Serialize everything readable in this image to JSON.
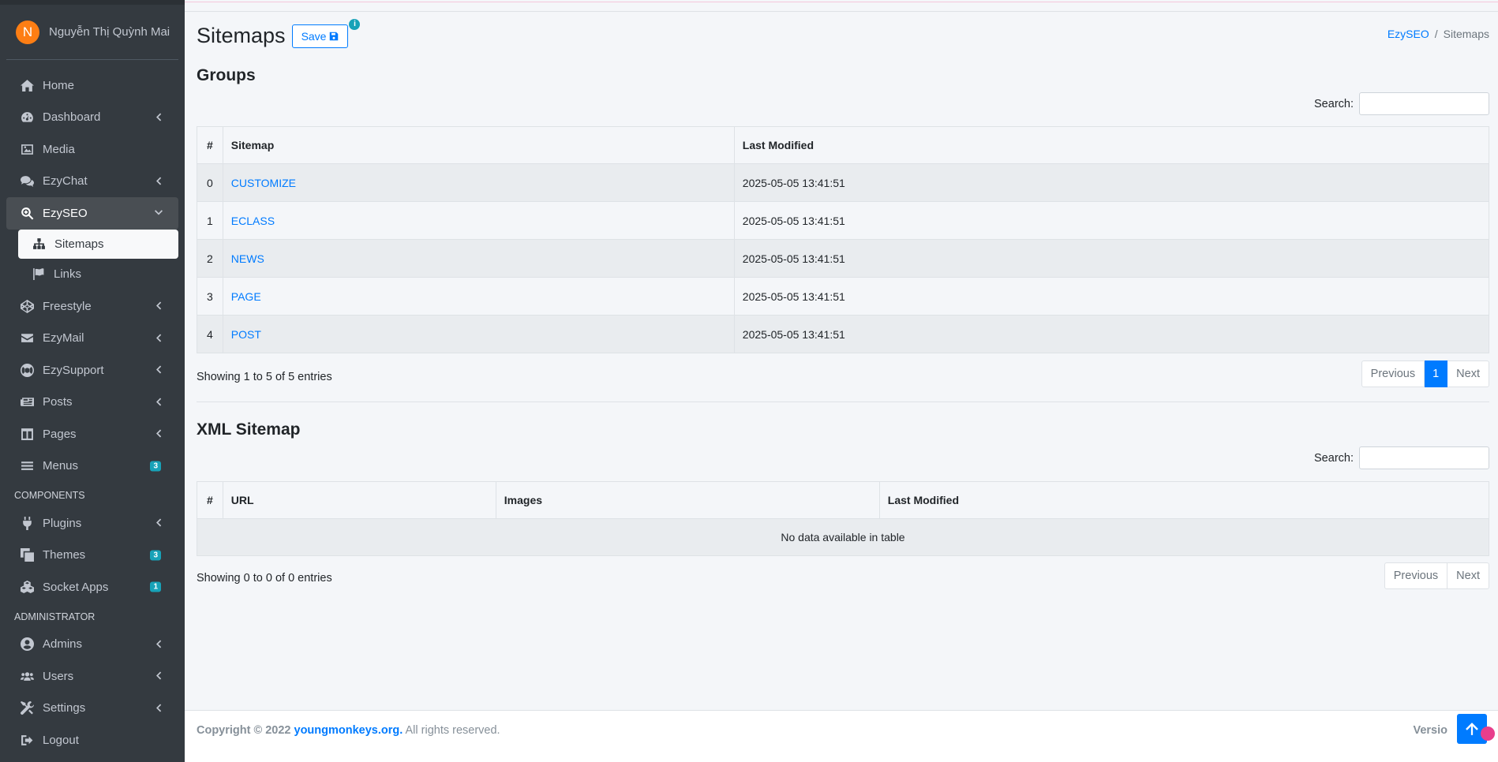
{
  "sidebar": {
    "user": {
      "initial": "N",
      "name": "Nguyễn Thị Quỳnh Mai"
    },
    "items": [
      {
        "label": "Home",
        "icon": "home-icon"
      },
      {
        "label": "Dashboard",
        "icon": "dashboard-icon"
      },
      {
        "label": "Media",
        "icon": "image-icon"
      },
      {
        "label": "EzyChat",
        "icon": "comments-icon"
      },
      {
        "label": "EzySEO",
        "icon": "search-plus-icon"
      },
      {
        "label": "Sitemaps",
        "icon": "sitemap-icon"
      },
      {
        "label": "Links",
        "icon": "flag-icon"
      },
      {
        "label": "Freestyle",
        "icon": "codepen-icon"
      },
      {
        "label": "EzyMail",
        "icon": "envelope-icon"
      },
      {
        "label": "EzySupport",
        "icon": "life-ring-icon"
      },
      {
        "label": "Posts",
        "icon": "newspaper-icon"
      },
      {
        "label": "Pages",
        "icon": "columns-icon"
      },
      {
        "label": "Menus",
        "icon": "bars-icon",
        "badge": "3"
      }
    ],
    "components_header": "COMPONENTS",
    "components": [
      {
        "label": "Plugins",
        "icon": "plug-icon"
      },
      {
        "label": "Themes",
        "icon": "clone-icon",
        "badge": "3"
      },
      {
        "label": "Socket Apps",
        "icon": "cubes-icon",
        "badge": "1"
      }
    ],
    "admin_header": "ADMINISTRATOR",
    "admin": [
      {
        "label": "Admins",
        "icon": "user-circle-icon"
      },
      {
        "label": "Users",
        "icon": "users-icon"
      },
      {
        "label": "Settings",
        "icon": "tools-icon"
      },
      {
        "label": "Logout",
        "icon": "sign-out-icon"
      }
    ]
  },
  "header": {
    "title": "Sitemaps",
    "save_label": "Save",
    "info_badge": "i",
    "breadcrumb": {
      "parent": "EzySEO",
      "separator": "/",
      "current": "Sitemaps"
    }
  },
  "groups": {
    "title": "Groups",
    "search_label": "Search:",
    "columns": [
      "#",
      "Sitemap",
      "Last Modified"
    ],
    "rows": [
      {
        "num": "0",
        "name": "CUSTOMIZE",
        "modified": "2025-05-05 13:41:51"
      },
      {
        "num": "1",
        "name": "ECLASS",
        "modified": "2025-05-05 13:41:51"
      },
      {
        "num": "2",
        "name": "NEWS",
        "modified": "2025-05-05 13:41:51"
      },
      {
        "num": "3",
        "name": "PAGE",
        "modified": "2025-05-05 13:41:51"
      },
      {
        "num": "4",
        "name": "POST",
        "modified": "2025-05-05 13:41:51"
      }
    ],
    "info": "Showing 1 to 5 of 5 entries",
    "pager": {
      "previous": "Previous",
      "page": "1",
      "next": "Next"
    }
  },
  "xml": {
    "title": "XML Sitemap",
    "search_label": "Search:",
    "columns": [
      "#",
      "URL",
      "Images",
      "Last Modified"
    ],
    "empty": "No data available in table",
    "info": "Showing 0 to 0 of 0 entries",
    "pager": {
      "previous": "Previous",
      "next": "Next"
    }
  },
  "footer": {
    "copyright_prefix": "Copyright © 2022",
    "link": "youngmonkeys.org.",
    "suffix": "All rights reserved.",
    "version": "Versio"
  },
  "colors": {
    "sidebar_bg": "#343a40",
    "accent": "#007bff",
    "badge": "#17a2b8",
    "avatar": "#fd7e14"
  }
}
